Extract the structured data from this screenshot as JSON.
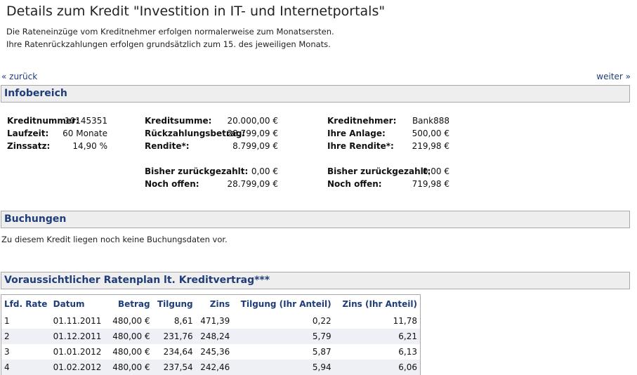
{
  "page": {
    "title": "Details zum Kredit \"Investition in IT- und Internetportals\"",
    "intro_line1": "Die Rateneinzüge vom Kreditnehmer erfolgen normalerweise zum Monatsersten.",
    "intro_line2": "Ihre Ratenrückzahlungen erfolgen grundsätzlich zum 15. des jeweiligen Monats.",
    "back_link": "« zurück",
    "next_link": "weiter »"
  },
  "infobereich": {
    "header": "Infobereich",
    "kreditnummer_label": "Kreditnummer:",
    "kreditnummer_value": "10145351",
    "laufzeit_label": "Laufzeit:",
    "laufzeit_value": "60 Monate",
    "zinssatz_label": "Zinssatz:",
    "zinssatz_value": "14,90 %",
    "kreditsumme_label": "Kreditsumme:",
    "kreditsumme_value": "20.000,00 €",
    "rueckzahlung_label": "Rückzahlungsbetrag:",
    "rueckzahlung_value": "28.799,09 €",
    "rendite_label": "Rendite*:",
    "rendite_value": "8.799,09 €",
    "bisher_label": "Bisher zurückgezahlt:",
    "bisher_value": "0,00 €",
    "offen_label": "Noch offen:",
    "offen_value": "28.799,09 €",
    "kreditnehmer_label": "Kreditnehmer:",
    "kreditnehmer_value": "Bank888",
    "anlage_label": "Ihre Anlage:",
    "anlage_value": "500,00 €",
    "ihre_rendite_label": "Ihre Rendite*:",
    "ihre_rendite_value": "219,98 €",
    "ihre_bisher_label": "Bisher zurückgezahlt:",
    "ihre_bisher_value": "0,00 €",
    "ihre_offen_label": "Noch offen:",
    "ihre_offen_value": "719,98 €"
  },
  "buchungen": {
    "header": "Buchungen",
    "notice": "Zu diesem Kredit liegen noch keine Buchungsdaten vor."
  },
  "ratenplan": {
    "header": "Voraussichtlicher Ratenplan lt. Kreditvertrag***",
    "columns": [
      "Lfd. Rate",
      "Datum",
      "Betrag",
      "Tilgung",
      "Zins",
      "Tilgung (Ihr Anteil)",
      "Zins (Ihr Anteil)"
    ],
    "rows": [
      [
        "1",
        "01.11.2011",
        "480,00 €",
        "8,61",
        "471,39",
        "0,22",
        "11,78"
      ],
      [
        "2",
        "01.12.2011",
        "480,00 €",
        "231,76",
        "248,24",
        "5,79",
        "6,21"
      ],
      [
        "3",
        "01.01.2012",
        "480,00 €",
        "234,64",
        "245,36",
        "5,87",
        "6,13"
      ],
      [
        "4",
        "01.02.2012",
        "480,00 €",
        "237,54",
        "242,46",
        "5,94",
        "6,06"
      ]
    ]
  }
}
